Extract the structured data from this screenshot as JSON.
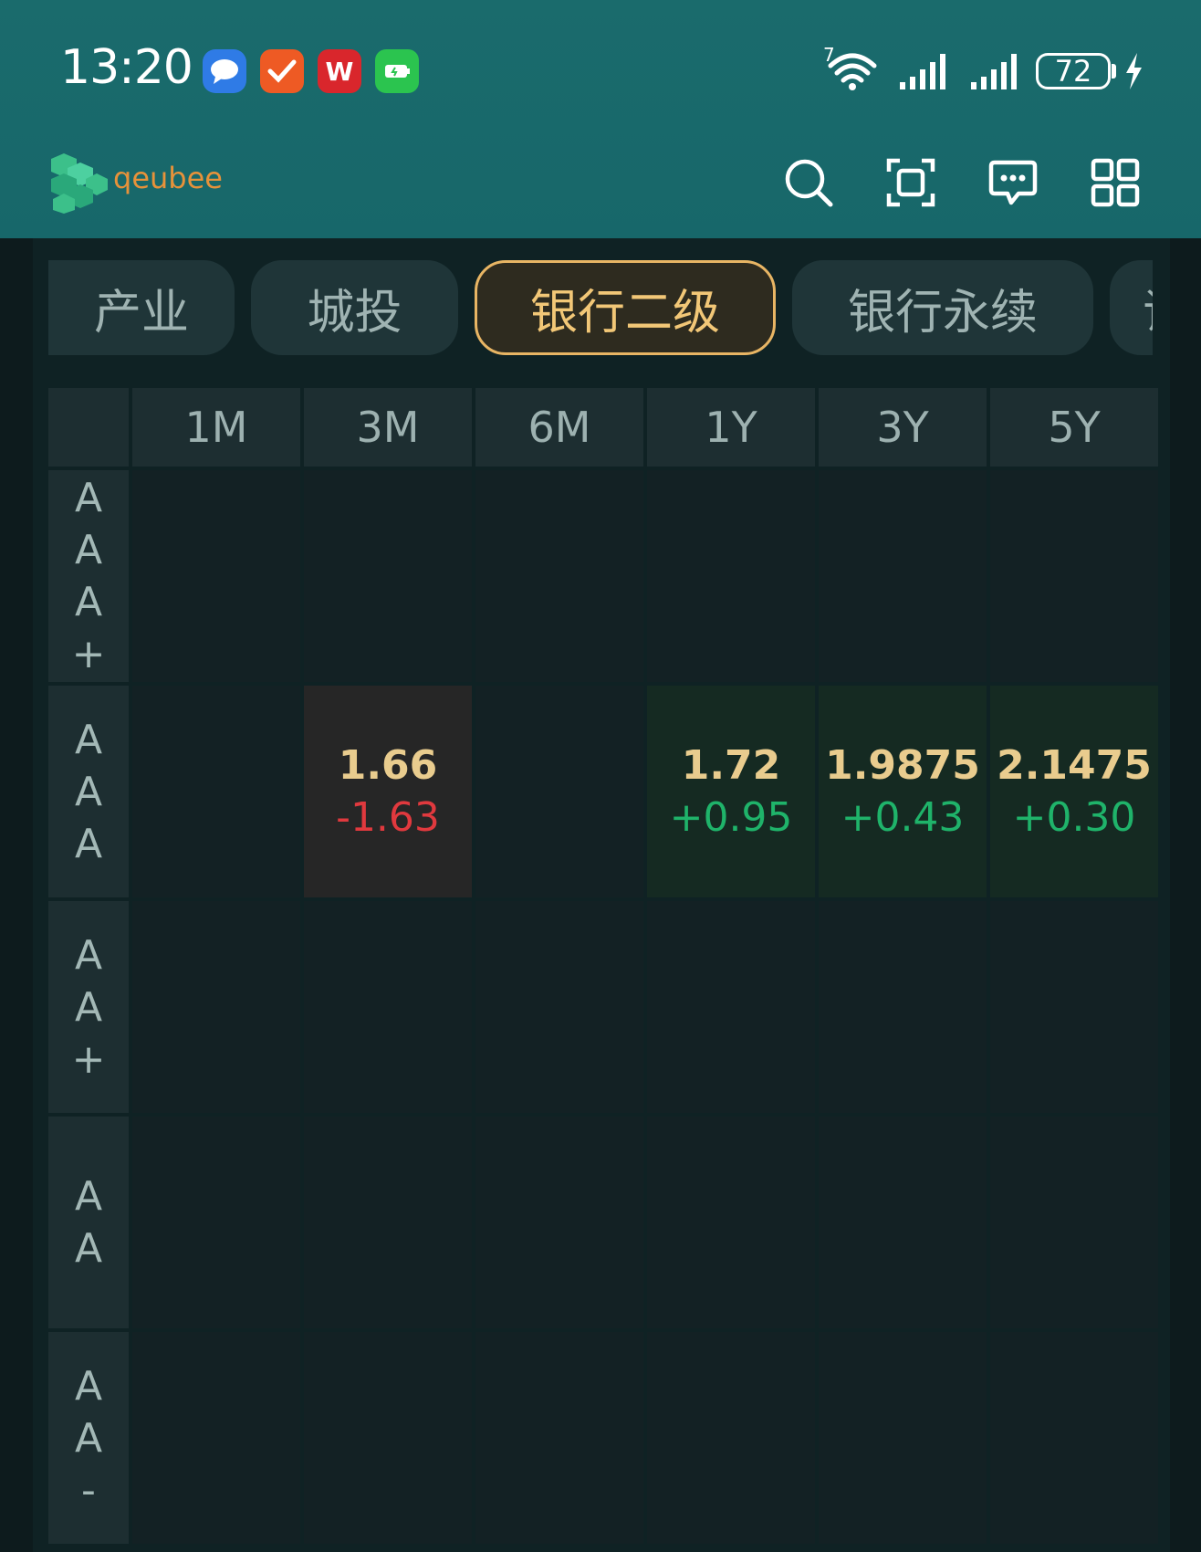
{
  "status_bar": {
    "time": "13:20",
    "wifi_badge": "7",
    "battery": "72",
    "app_icons": [
      "message-icon",
      "task-check-icon",
      "wps-icon",
      "battery-app-icon"
    ],
    "wps_label": "W"
  },
  "header": {
    "logo_text": "qeubee",
    "icons": [
      "search-icon",
      "scan-icon",
      "chat-icon",
      "grid-menu-icon"
    ]
  },
  "tabs": [
    {
      "label": "产业",
      "active": false
    },
    {
      "label": "城投",
      "active": false
    },
    {
      "label": "银行二级",
      "active": true
    },
    {
      "label": "银行永续",
      "active": false
    },
    {
      "label": "证",
      "active": false
    }
  ],
  "table": {
    "columns": [
      "1M",
      "3M",
      "6M",
      "1Y",
      "3Y",
      "5Y"
    ],
    "rows": [
      {
        "rating": [
          "A",
          "A",
          "A",
          "+"
        ],
        "cells": [
          null,
          null,
          null,
          null,
          null,
          null
        ]
      },
      {
        "rating": [
          "A",
          "A",
          "A"
        ],
        "cells": [
          null,
          {
            "yield": "1.66",
            "change": "-1.63",
            "direction": "down"
          },
          null,
          {
            "yield": "1.72",
            "change": "+0.95",
            "direction": "up"
          },
          {
            "yield": "1.9875",
            "change": "+0.43",
            "direction": "up"
          },
          {
            "yield": "2.1475",
            "change": "+0.30",
            "direction": "up"
          }
        ]
      },
      {
        "rating": [
          "A",
          "A",
          "+"
        ],
        "cells": [
          null,
          null,
          null,
          null,
          null,
          null
        ]
      },
      {
        "rating": [
          "A",
          "A"
        ],
        "cells": [
          null,
          null,
          null,
          null,
          null,
          null
        ]
      },
      {
        "rating": [
          "A",
          "A",
          "-"
        ],
        "cells": [
          null,
          null,
          null,
          null,
          null,
          null
        ]
      }
    ]
  },
  "colors": {
    "header_bg": "#17676a",
    "accent": "#e8b564",
    "negative": "#e0393e",
    "positive": "#1fb36a",
    "negative_cell_bg": "#262626",
    "positive_cell_bg": "#152a22"
  }
}
